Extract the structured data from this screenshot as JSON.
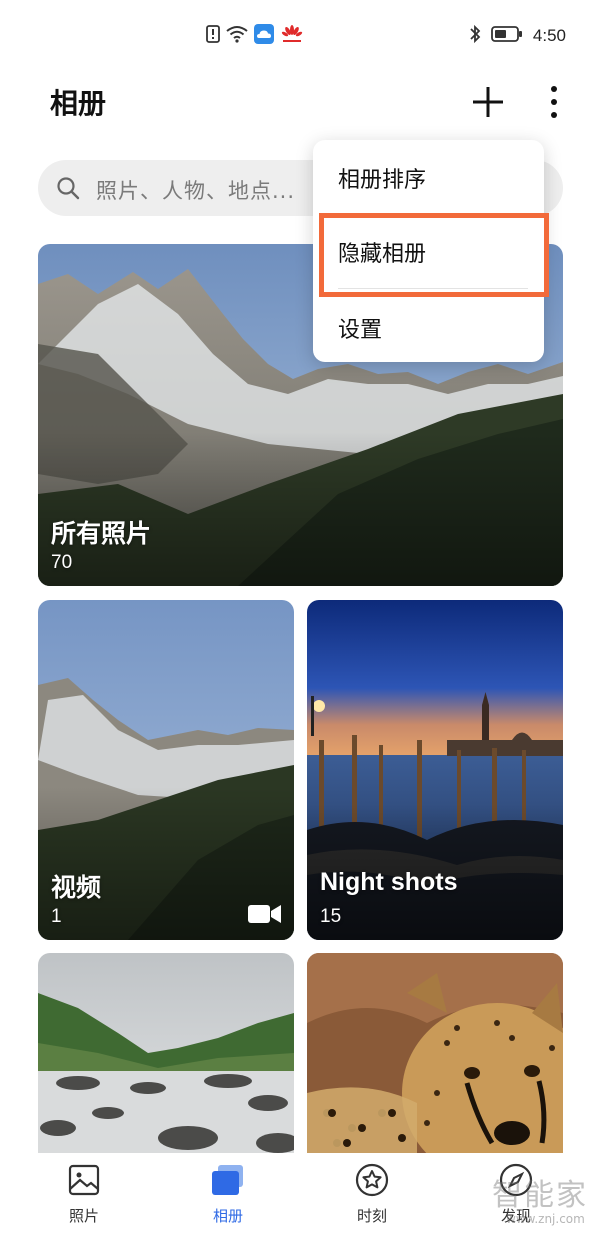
{
  "status_bar": {
    "time": "4:50",
    "icons": [
      "notification-alert-icon",
      "wifi-icon",
      "cloud-icon",
      "huawei-logo-icon",
      "bluetooth-icon",
      "battery-icon"
    ]
  },
  "header": {
    "title": "相册",
    "add_icon": "plus-icon",
    "more_icon": "more-vertical-icon"
  },
  "search": {
    "placeholder": "照片、人物、地点..."
  },
  "albums": [
    {
      "name": "所有照片",
      "count": "70"
    },
    {
      "name": "视频",
      "count": "1",
      "badge_icon": "video-camera-icon"
    },
    {
      "name": "Night shots",
      "count": "15"
    },
    {
      "name": "",
      "count": ""
    },
    {
      "name": "",
      "count": ""
    }
  ],
  "menu": {
    "items": [
      {
        "label": "相册排序"
      },
      {
        "label": "隐藏相册"
      },
      {
        "label": "设置"
      }
    ],
    "highlight_color": "#f26a3a"
  },
  "bottom_nav": {
    "items": [
      {
        "label": "照片",
        "icon": "image-icon"
      },
      {
        "label": "相册",
        "icon": "albums-icon",
        "active": true
      },
      {
        "label": "时刻",
        "icon": "star-circle-icon"
      },
      {
        "label": "发现",
        "icon": "discover-icon"
      }
    ],
    "active_color": "#2f6ae5"
  },
  "watermark": {
    "text": "智能家",
    "url": "www.znj.com"
  }
}
